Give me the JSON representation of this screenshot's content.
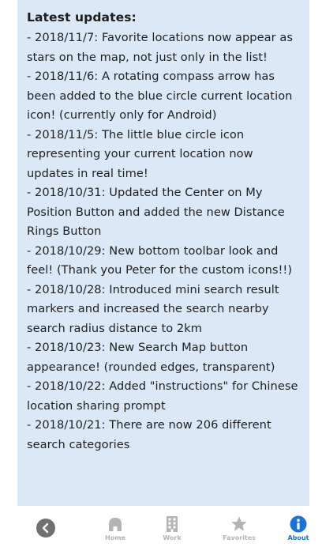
{
  "updates": {
    "title": "Latest updates:",
    "items": [
      "- 2018/11/7: Favorite locations now appear as stars on the map, not just only in the list!",
      "- 2018/11/6: A rotating compass arrow has been added to the blue circle current location icon! (currently only for Android)",
      "- 2018/11/5: The little blue circle icon representing your current location now updates in real time!",
      "- 2018/10/31: Updated the Center on My Position Button and added the new Distance Rings Button",
      "- 2018/10/29: New bottom toolbar look and feel! (Thank you Peter for the custom icons!!)",
      "- 2018/10/28: Introduced mini search result markers and increased the search nearby search radius distance to 2km",
      "- 2018/10/23: New Search Map button appearance! (rounded edges, transparent)",
      "- 2018/10/22: Added \"instructions\" for Chinese location sharing prompt",
      "- 2018/10/21: There are now 206 different search categories"
    ]
  },
  "toolbar": {
    "back_icon": "chevron-left-icon",
    "items": [
      {
        "label": "Home",
        "icon": "home-icon",
        "active": false
      },
      {
        "label": "Work",
        "icon": "building-icon",
        "active": false
      },
      {
        "label": "Favorites",
        "icon": "star-icon",
        "active": false
      },
      {
        "label": "About",
        "icon": "info-icon",
        "active": true
      }
    ],
    "colors": {
      "inactive": "#b4b4b4",
      "active": "#1a73d9",
      "back_bg": "#707070"
    }
  },
  "colors": {
    "panel_bg": "#dae8f8",
    "text": "#1f1f1f"
  }
}
